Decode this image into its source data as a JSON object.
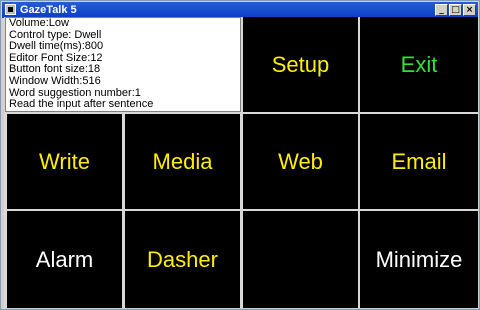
{
  "window": {
    "title": "GazeTalk 5"
  },
  "title_controls": {
    "minimize": "_",
    "maximize": "□",
    "close": "×"
  },
  "info_panel": {
    "lines": [
      "Volume:Low",
      "Control type: Dwell",
      "Dwell time(ms):800",
      "Editor Font Size:12",
      "Button font size:18",
      "Window Width:516",
      "Word suggestion number:1",
      "Read the input after sentence"
    ]
  },
  "buttons": {
    "setup": "Setup",
    "exit": "Exit",
    "write": "Write",
    "media": "Media",
    "web": "Web",
    "email": "Email",
    "alarm": "Alarm",
    "dasher": "Dasher",
    "empty": "",
    "minimize": "Minimize"
  },
  "colors": {
    "yellow": "#ffee00",
    "green": "#33e033",
    "white": "#ffffff",
    "cell_bg": "#000000"
  }
}
